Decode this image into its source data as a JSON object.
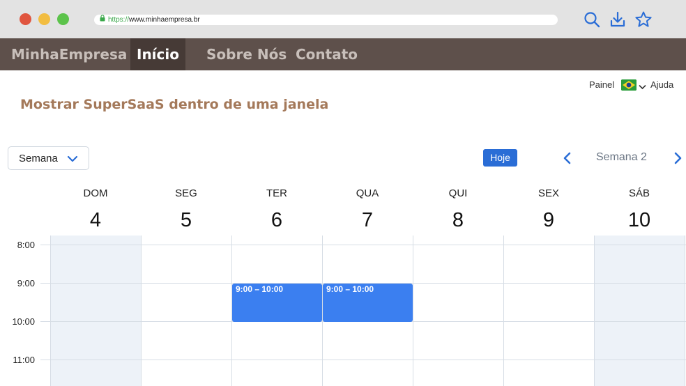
{
  "browser": {
    "url_scheme": "https://",
    "url_host": "www.minhaempresa.br",
    "icons": [
      "search-icon",
      "download-icon",
      "star-icon"
    ],
    "accent": "#2a6dd6"
  },
  "site_nav": {
    "brand": "MinhaEmpresa",
    "items": [
      {
        "label": "Início",
        "active": true
      },
      {
        "label": "Sobre Nós",
        "active": false
      },
      {
        "label": "Contato",
        "active": false
      }
    ]
  },
  "top_links": {
    "panel": "Painel",
    "language_flag": "brazil-flag-icon",
    "help": "Ajuda"
  },
  "page": {
    "title": "Mostrar SuperSaaS dentro de uma janela"
  },
  "calendar": {
    "view_select": "Semana",
    "today_button": "Hoje",
    "week_label": "Semana 2",
    "days": [
      {
        "name": "DOM",
        "num": "4",
        "weekend": true
      },
      {
        "name": "SEG",
        "num": "5",
        "weekend": false
      },
      {
        "name": "TER",
        "num": "6",
        "weekend": false
      },
      {
        "name": "QUA",
        "num": "7",
        "weekend": false
      },
      {
        "name": "QUI",
        "num": "8",
        "weekend": false
      },
      {
        "name": "SEX",
        "num": "9",
        "weekend": false
      },
      {
        "name": "SÁB",
        "num": "10",
        "weekend": true
      }
    ],
    "times": [
      "8:00",
      "9:00",
      "10:00",
      "11:00"
    ],
    "events": [
      {
        "label": "9:00 – 10:00",
        "day": "TER",
        "color": "#3b7ff0"
      },
      {
        "label": "9:00 – 10:00",
        "day": "QUA",
        "color": "#3b7ff0"
      }
    ],
    "weekend_color": "#edf2f8"
  }
}
